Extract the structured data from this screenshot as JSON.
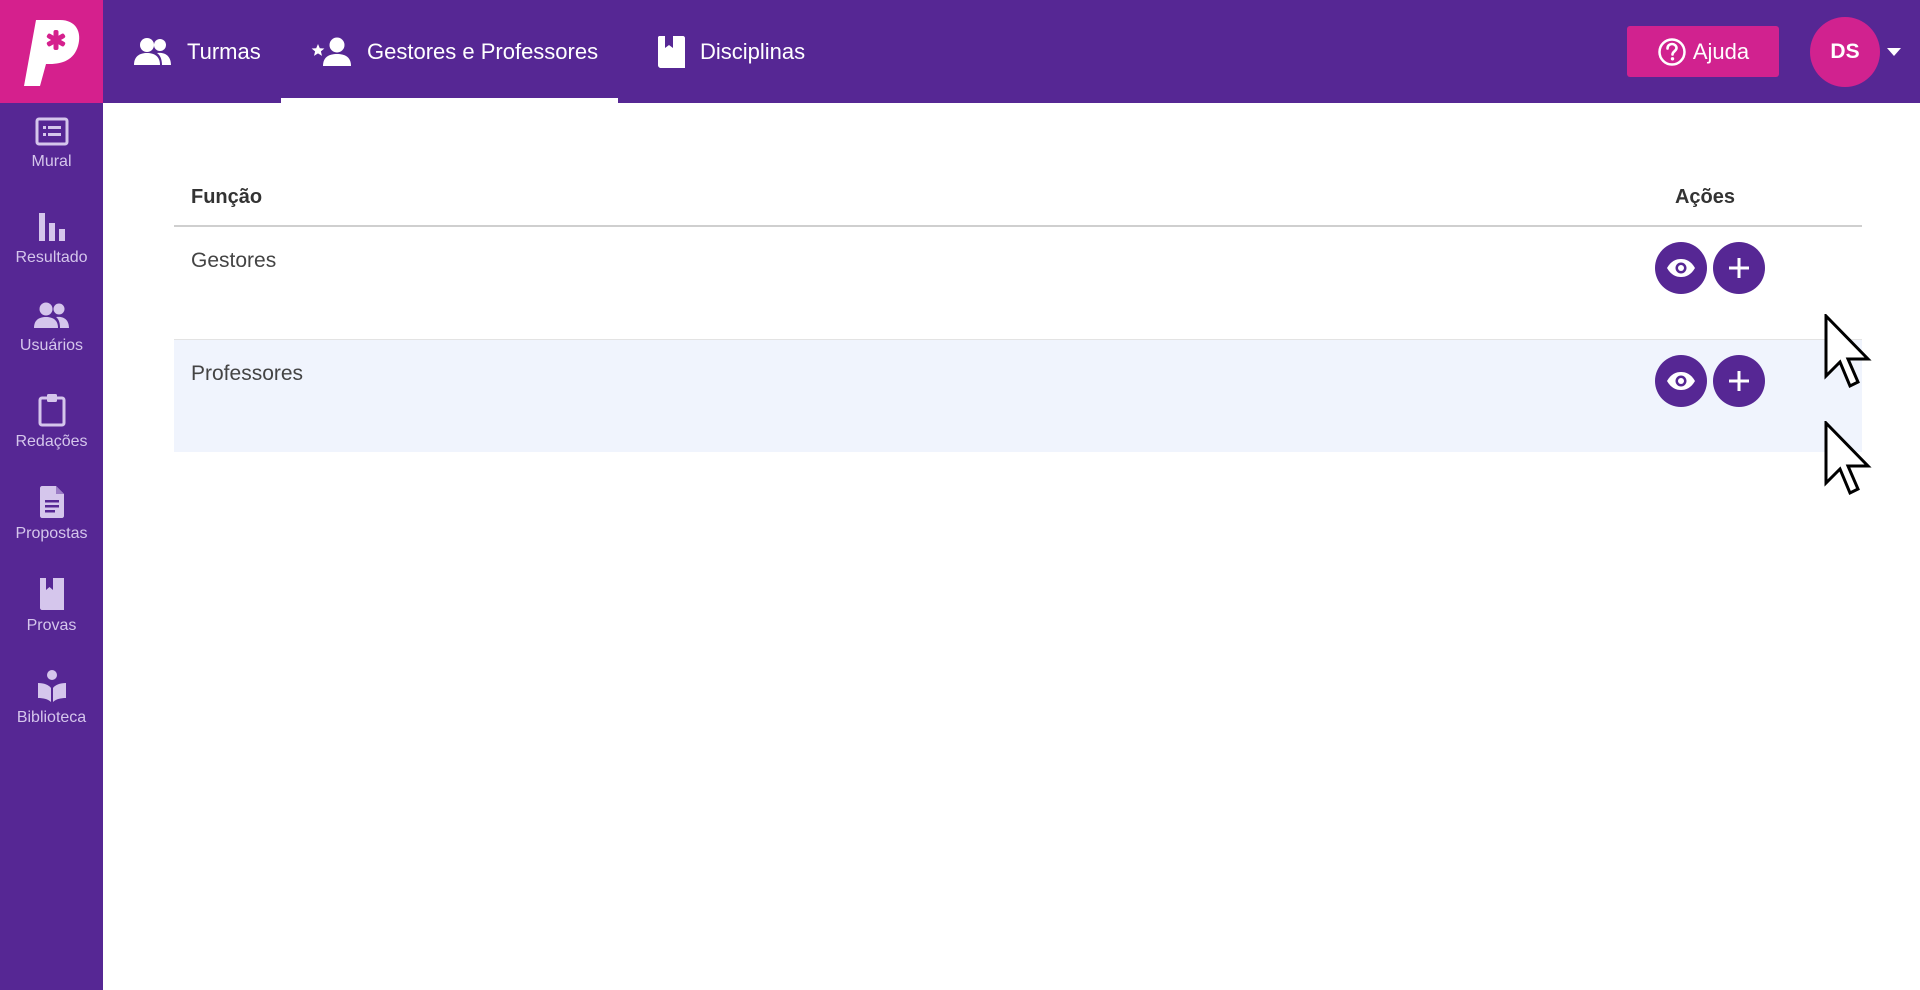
{
  "app": {
    "logo_letter": "P",
    "brand_color": "#562794",
    "accent_color": "#d1228f"
  },
  "topnav": {
    "tabs": [
      {
        "label": "Turmas",
        "icon": "users-icon",
        "active": false
      },
      {
        "label": "Gestores e Professores",
        "icon": "user-star-icon",
        "active": true
      },
      {
        "label": "Disciplinas",
        "icon": "book-icon",
        "active": false
      }
    ],
    "help_label": "Ajuda",
    "avatar_initials": "DS"
  },
  "sidebar": {
    "items": [
      {
        "label": "Mural",
        "icon": "board-icon"
      },
      {
        "label": "Resultado",
        "icon": "bar-chart-icon"
      },
      {
        "label": "Usuários",
        "icon": "users-icon"
      },
      {
        "label": "Redações",
        "icon": "clipboard-icon"
      },
      {
        "label": "Propostas",
        "icon": "document-icon"
      },
      {
        "label": "Provas",
        "icon": "exam-book-icon"
      },
      {
        "label": "Biblioteca",
        "icon": "reader-icon"
      }
    ]
  },
  "table": {
    "headers": {
      "function": "Função",
      "actions": "Ações"
    },
    "rows": [
      {
        "name": "Gestores"
      },
      {
        "name": "Professores"
      }
    ]
  }
}
